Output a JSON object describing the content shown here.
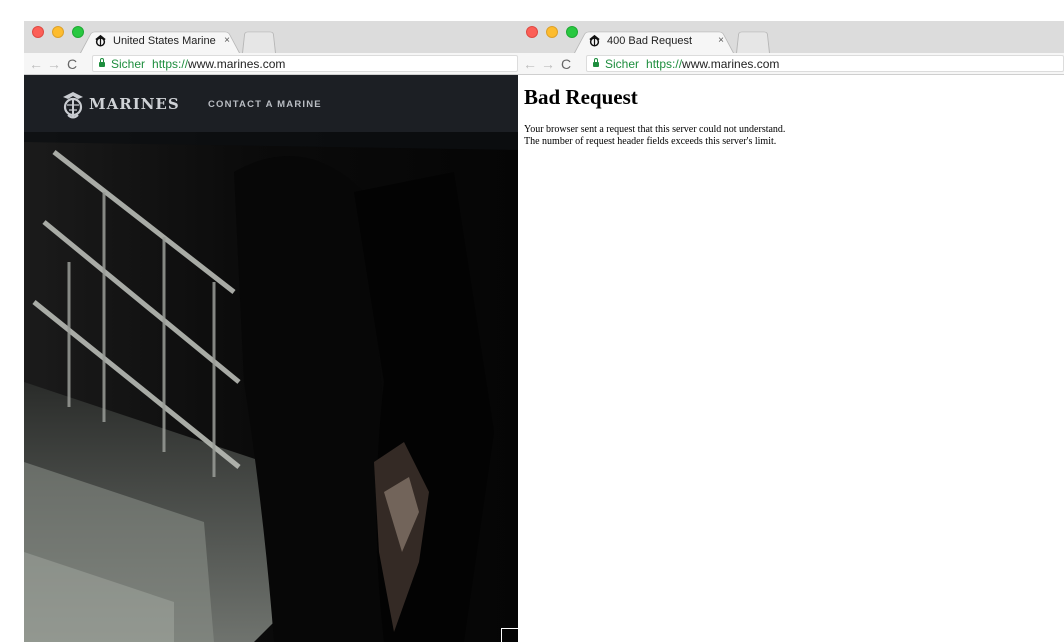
{
  "left_window": {
    "tab": {
      "title": "United States Marine Corps | Y",
      "close": "×"
    },
    "nav": {
      "back": "←",
      "forward": "→",
      "reload": "C"
    },
    "omnibox": {
      "secure": "Sicher",
      "scheme": "https://",
      "host": "www.marines.com"
    },
    "site": {
      "logo_text": "MARINES",
      "contact_link": "CONTACT A MARINE"
    }
  },
  "right_window": {
    "tab": {
      "title": "400 Bad Request",
      "close": "×"
    },
    "nav": {
      "back": "←",
      "forward": "→",
      "reload": "C"
    },
    "omnibox": {
      "secure": "Sicher",
      "scheme": "https://",
      "host": "www.marines.com"
    },
    "page": {
      "heading": "Bad Request",
      "line1": "Your browser sent a request that this server could not understand.",
      "line2": "The number of request header fields exceeds this server's limit."
    }
  }
}
